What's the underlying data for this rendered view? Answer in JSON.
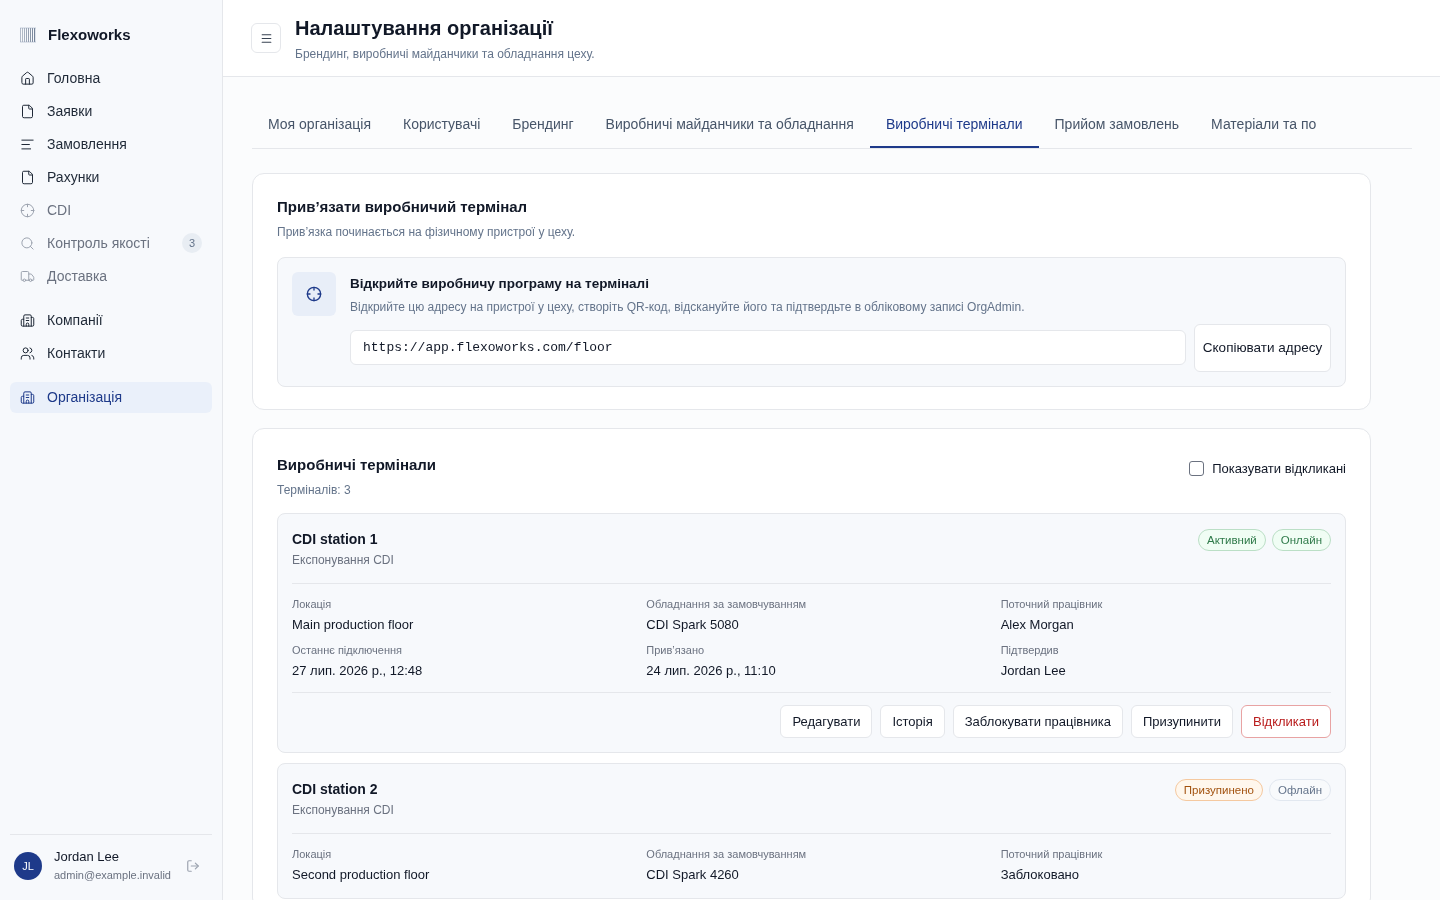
{
  "sidebar": {
    "brand": "Flexoworks",
    "items": [
      {
        "label": "Головна",
        "selected": false,
        "disabled": false
      },
      {
        "label": "Заявки",
        "selected": false,
        "disabled": false
      },
      {
        "label": "Замовлення",
        "selected": false,
        "disabled": false
      },
      {
        "label": "Рахунки",
        "selected": false,
        "disabled": false
      },
      {
        "label": "CDI",
        "selected": false,
        "disabled": true
      },
      {
        "label": "Контроль якості",
        "selected": false,
        "disabled": true,
        "badge": "3"
      },
      {
        "label": "Доставка",
        "selected": false,
        "disabled": true
      },
      {
        "label": "Компанії",
        "selected": false,
        "disabled": false,
        "group_start": true
      },
      {
        "label": "Контакти",
        "selected": false,
        "disabled": false
      },
      {
        "label": "Організація",
        "selected": true,
        "disabled": false,
        "group_start": true
      }
    ],
    "user": {
      "initials": "JL",
      "name": "Jordan Lee",
      "email": "admin@example.invalid"
    }
  },
  "header": {
    "title": "Налаштування організації",
    "subtitle": "Брендинг, виробничі майданчики та обладнання цеху."
  },
  "tabs": [
    {
      "label": "Моя організація",
      "selected": false
    },
    {
      "label": "Користувачі",
      "selected": false
    },
    {
      "label": "Брендинг",
      "selected": false
    },
    {
      "label": "Виробничі майданчики та обладнання",
      "selected": false
    },
    {
      "label": "Виробничі термінали",
      "selected": true
    },
    {
      "label": "Прийом замовлень",
      "selected": false
    },
    {
      "label": "Матеріали та по",
      "selected": false
    }
  ],
  "bind_card": {
    "title": "Прив’язати виробничий термінал",
    "subtitle": "Прив’язка починається на фізичному пристрої у цеху.",
    "step": {
      "title": "Відкрийте виробничу програму на терміналі",
      "text": "Відкрийте цю адресу на пристрої у цеху, створіть QR-код, відскануйте його та підтвердьте в обліковому записі OrgAdmin.",
      "url": "https://app.flexoworks.com/floor",
      "copy_button": "Скопіювати адресу"
    }
  },
  "terminals": {
    "title": "Виробничі термінали",
    "count": "Терміналів: 3",
    "show_revoked": {
      "label": "Показувати відкликані",
      "checked": false
    },
    "items": [
      {
        "name": "CDI station 1",
        "type": "Експонування CDI",
        "badges": [
          {
            "label": "Активний",
            "kind": "success"
          },
          {
            "label": "Онлайн",
            "kind": "success"
          }
        ],
        "fields": [
          {
            "label": "Локація",
            "value": "Main production floor"
          },
          {
            "label": "Обладнання за замовчуванням",
            "value": "CDI Spark 5080"
          },
          {
            "label": "Поточний працівник",
            "value": "Alex Morgan"
          },
          {
            "label": "Останнє підключення",
            "value": "27 лип. 2026 р., 12:48"
          },
          {
            "label": "Прив’язано",
            "value": "24 лип. 2026 р., 11:10"
          },
          {
            "label": "Підтвердив",
            "value": "Jordan Lee"
          }
        ],
        "actions": [
          {
            "label": "Редагувати",
            "kind": "default"
          },
          {
            "label": "Історія",
            "kind": "default"
          },
          {
            "label": "Заблокувати працівника",
            "kind": "default"
          },
          {
            "label": "Призупинити",
            "kind": "default"
          },
          {
            "label": "Відкликати",
            "kind": "danger"
          }
        ]
      },
      {
        "name": "CDI station 2",
        "type": "Експонування CDI",
        "badges": [
          {
            "label": "Призупинено",
            "kind": "warning"
          },
          {
            "label": "Офлайн",
            "kind": "neutral"
          }
        ],
        "fields": [
          {
            "label": "Локація",
            "value": "Second production floor"
          },
          {
            "label": "Обладнання за замовчуванням",
            "value": "CDI Spark 4260"
          },
          {
            "label": "Поточний працівник",
            "value": "Заблоковано"
          }
        ]
      }
    ]
  }
}
